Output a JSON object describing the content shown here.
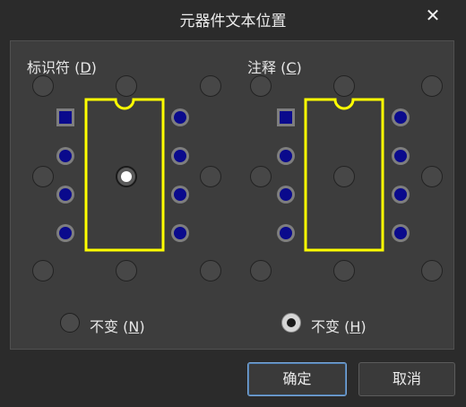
{
  "window": {
    "title": "元器件文本位置",
    "close_symbol": "✕"
  },
  "designator": {
    "label_text": "标识符 (",
    "label_key": "D",
    "label_end": ")",
    "unchanged_text": "不变 (",
    "unchanged_key": "N",
    "unchanged_end": ")",
    "unchanged_selected": false,
    "selected_position": "center"
  },
  "comment": {
    "label_text": "注释 (",
    "label_key": "C",
    "label_end": ")",
    "unchanged_text": "不变 (",
    "unchanged_key": "H",
    "unchanged_end": ")",
    "unchanged_selected": true,
    "selected_position": "none"
  },
  "buttons": {
    "ok": "确定",
    "cancel": "取消"
  },
  "colors": {
    "chip_outline": "#ffff00",
    "pin_fill": "#0a0a8c"
  }
}
